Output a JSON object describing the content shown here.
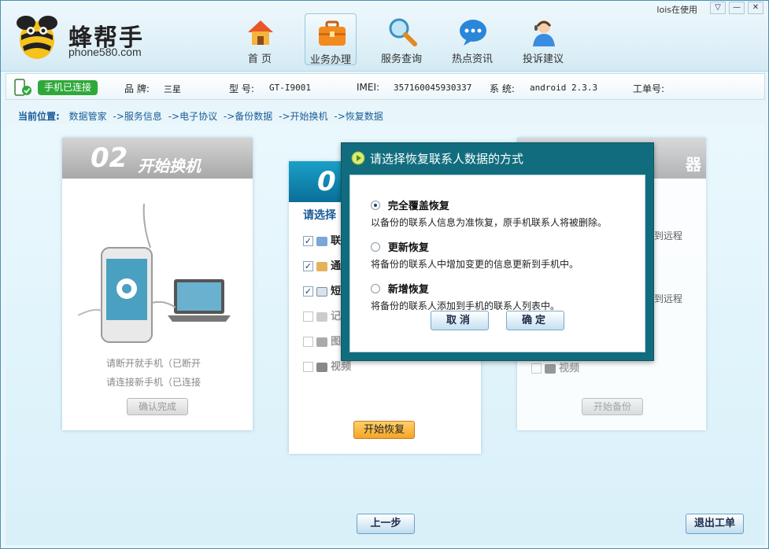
{
  "app": {
    "brand_name": "蜂帮手",
    "brand_url": "phone580.com",
    "user_status": "lois在使用"
  },
  "nav": [
    {
      "label": "首 页",
      "icon": "home-icon",
      "active": false
    },
    {
      "label": "业务办理",
      "icon": "briefcase-icon",
      "active": true
    },
    {
      "label": "服务查询",
      "icon": "magnifier-icon",
      "active": false
    },
    {
      "label": "热点资讯",
      "icon": "chat-bubble-icon",
      "active": false
    },
    {
      "label": "投诉建议",
      "icon": "support-agent-icon",
      "active": false
    }
  ],
  "window_controls": {
    "menu": "▽",
    "minimize": "—",
    "close": "✕"
  },
  "device": {
    "status": "手机已连接",
    "brand_label": "品 牌:",
    "brand": "三星",
    "model_label": "型 号:",
    "model": "GT-I9001",
    "imei_label": "IMEI:",
    "imei": "357160045930337",
    "system_label": "系 统:",
    "system": "android 2.3.3",
    "ticket_label": "工单号:",
    "ticket": ""
  },
  "breadcrumb": {
    "lead": "当前位置:",
    "items": [
      "数据管家",
      "->服务信息",
      "->电子协议",
      "->备份数据",
      "->开始换机",
      "->恢复数据"
    ]
  },
  "step2": {
    "number": "02",
    "title": "开始换机",
    "note1": "请断开就手机（已断开",
    "note2": "请连接新手机（已连接",
    "confirm": "确认完成"
  },
  "step3": {
    "number": "0",
    "select_label": "请选择",
    "items": [
      {
        "label": "联",
        "checked": true
      },
      {
        "label": "通",
        "checked": true
      },
      {
        "label": "短",
        "checked": true
      },
      {
        "label": "记",
        "checked": false
      },
      {
        "label": "图",
        "checked": false
      },
      {
        "label": "视频",
        "checked": false
      }
    ],
    "start_restore": "开始恢复"
  },
  "step4": {
    "title_fragment": "器",
    "mark": "！",
    "remote1": "份到远程",
    "remote2": "份到远程",
    "video": "视频",
    "start_backup": "开始备份"
  },
  "dialog": {
    "title": "请选择恢复联系人数据的方式",
    "options": [
      {
        "title": "完全覆盖恢复",
        "desc": "以备份的联系人信息为准恢复，原手机联系人将被删除。",
        "selected": true
      },
      {
        "title": "更新恢复",
        "desc": "将备份的联系人中增加变更的信息更新到手机中。",
        "selected": false
      },
      {
        "title": "新增恢复",
        "desc": "将备份的联系人添加到手机的联系人列表中。",
        "selected": false
      }
    ],
    "cancel": "取消",
    "ok": "确定"
  },
  "footer": {
    "prev": "上一步",
    "exit": "退出工单"
  }
}
